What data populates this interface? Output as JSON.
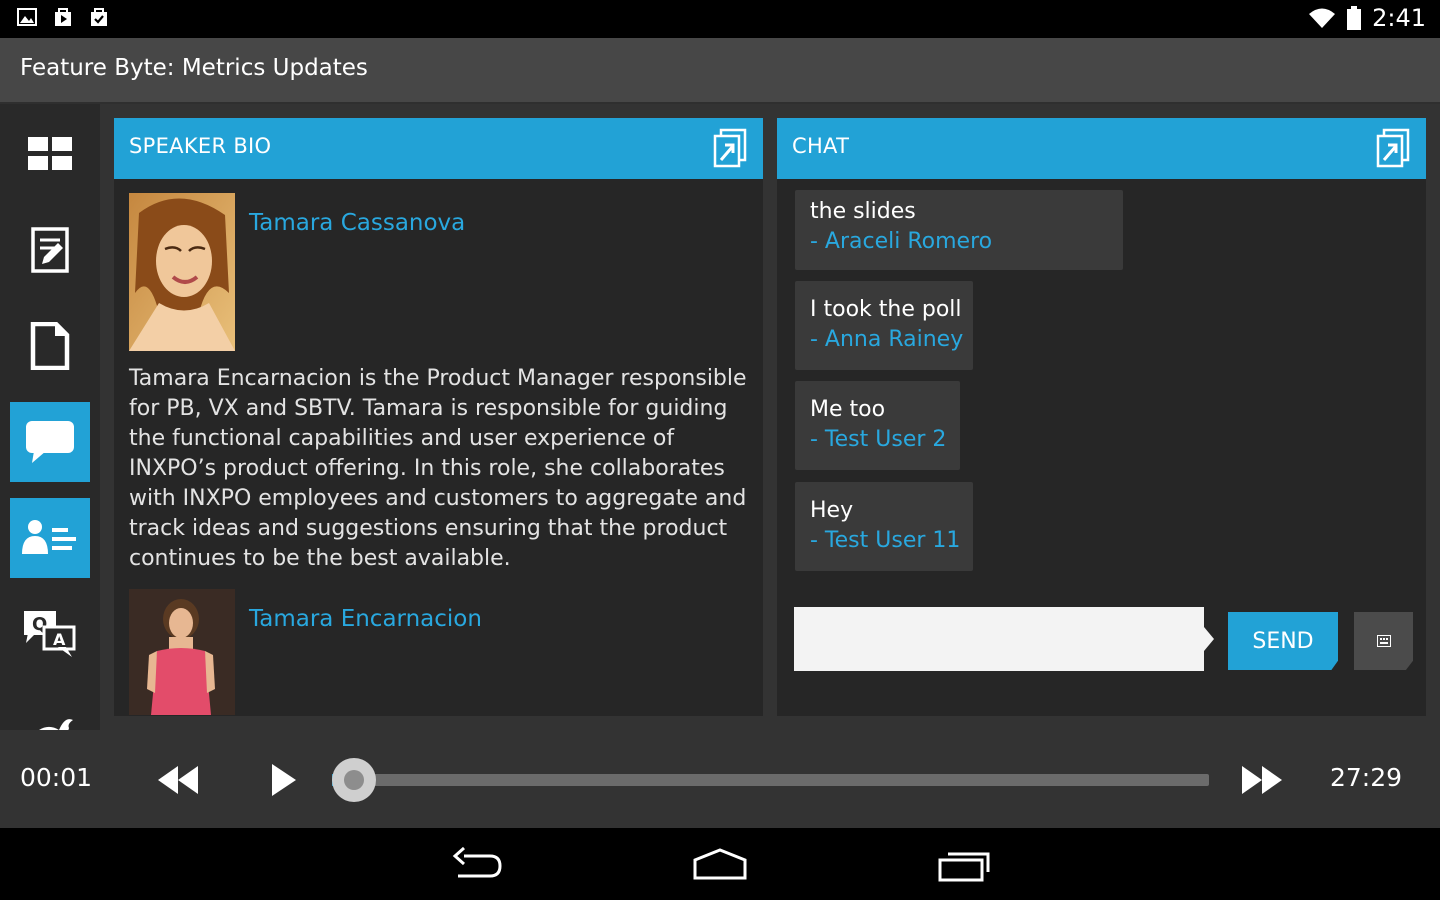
{
  "status_bar": {
    "time": "2:41",
    "notification_icons": [
      "gallery-icon",
      "play-store-icon",
      "shopping-bag-icon"
    ],
    "system_icons": [
      "wifi-icon",
      "battery-icon"
    ]
  },
  "app_bar": {
    "title": "Feature Byte: Metrics Updates"
  },
  "sidebar": {
    "items": [
      {
        "name": "dashboard",
        "icon": "grid-icon",
        "active": false
      },
      {
        "name": "notes",
        "icon": "notepad-icon",
        "active": false
      },
      {
        "name": "documents",
        "icon": "document-icon",
        "active": false
      },
      {
        "name": "chat",
        "icon": "chat-bubble-icon",
        "active": true
      },
      {
        "name": "speaker-bio",
        "icon": "profile-card-icon",
        "active": true
      },
      {
        "name": "qa",
        "icon": "qa-icon",
        "active": false
      },
      {
        "name": "twitter",
        "icon": "bird-icon",
        "active": false
      }
    ]
  },
  "speaker_bio": {
    "header": "SPEAKER BIO",
    "speakers": [
      {
        "name": "Tamara Cassanova"
      },
      {
        "name": "Tamara Encarnacion"
      }
    ],
    "bio": "Tamara Encarnacion is the Product Manager responsible for PB, VX and SBTV. Tamara is responsible for guiding the functional capabilities and user experience of INXPO’s product offering. In this role, she collaborates with INXPO employees and customers to aggregate and track ideas and suggestions ensuring that the product continues to be the best available."
  },
  "chat": {
    "header": "CHAT",
    "messages": [
      {
        "text": "the slides",
        "author": "- Araceli Romero"
      },
      {
        "text": "I took the poll",
        "author": "- Anna Rainey"
      },
      {
        "text": "Me too",
        "author": "- Test User 2"
      },
      {
        "text": "Hey",
        "author": "- Test User 11"
      }
    ],
    "input_value": "",
    "send_label": "SEND"
  },
  "player": {
    "current_time": "00:01",
    "duration": "27:29",
    "progress_fraction": 0.0006
  },
  "colors": {
    "accent": "#22a2d6",
    "link": "#29a8df",
    "panel_bg": "#262626",
    "chat_bubble": "#3a3a3a"
  }
}
